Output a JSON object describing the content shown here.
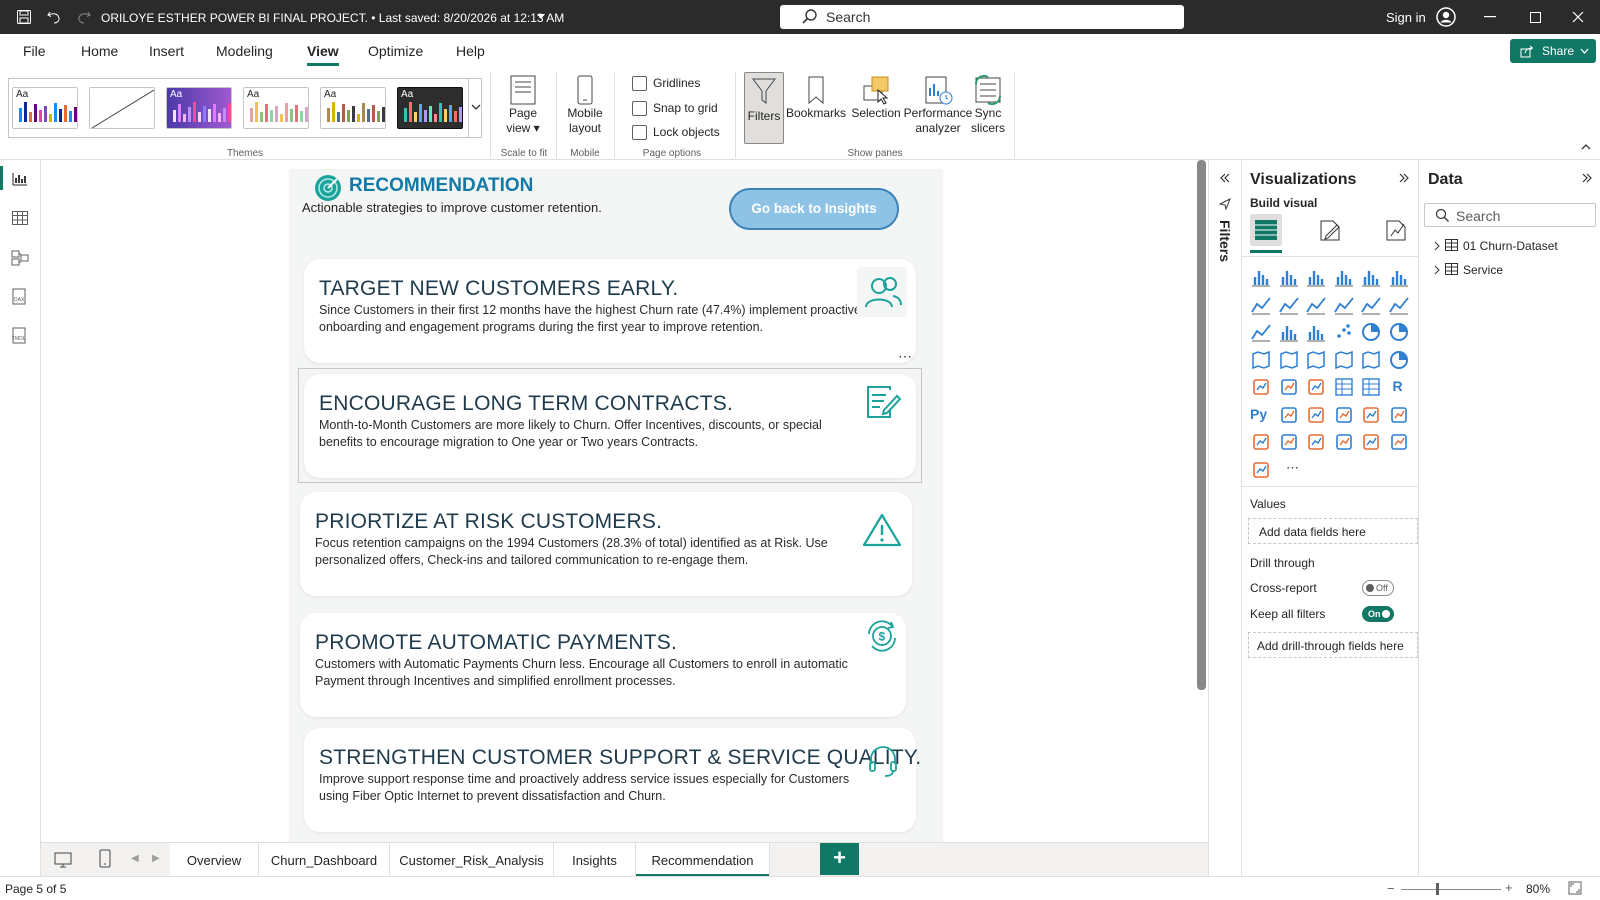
{
  "titlebar": {
    "title": "ORILOYE ESTHER POWER BI FINAL PROJECT. • Last saved: 8/20/2026 at 12:13 AM",
    "search_placeholder": "Search",
    "signin": "Sign in"
  },
  "menu": {
    "items": [
      "File",
      "Home",
      "Insert",
      "Modeling",
      "View",
      "Optimize",
      "Help"
    ],
    "active": "View",
    "share": "Share"
  },
  "ribbon": {
    "groups": {
      "themes": "Themes",
      "scale": "Scale to fit",
      "mobile": "Mobile",
      "page_options": "Page options",
      "show_panes": "Show panes"
    },
    "page_view": {
      "line1": "Page",
      "line2": "view"
    },
    "mobile_layout": {
      "line1": "Mobile",
      "line2": "layout"
    },
    "gridlines": "Gridlines",
    "snap_to_grid": "Snap to grid",
    "lock_objects": "Lock objects",
    "filters": "Filters",
    "bookmarks": "Bookmarks",
    "selection": "Selection",
    "performance": {
      "line1": "Performance",
      "line2": "analyzer"
    },
    "sync_slicers": {
      "line1": "Sync",
      "line2": "slicers"
    },
    "theme_aa": "Aa"
  },
  "report": {
    "heading": "RECOMMENDATION",
    "subheading": "Actionable strategies to improve customer retention.",
    "back_button": "Go back to Insights",
    "cards": [
      {
        "title": "TARGET NEW CUSTOMERS EARLY.",
        "body": "Since Customers in their first 12 months have the highest Churn rate (47.4%) implement proactive onboarding and engagement programs during the first year to improve retention.",
        "icon": "users-icon"
      },
      {
        "title": "ENCOURAGE LONG TERM CONTRACTS.",
        "body": "Month-to-Month Customers are more likely to Churn. Offer Incentives, discounts, or special benefits to encourage migration to One year or Two years Contracts.",
        "icon": "contract-edit-icon"
      },
      {
        "title": "PRIORTIZE AT RISK CUSTOMERS.",
        "body": "Focus retention campaigns on the 1994 Customers (28.3% of total) identified as at Risk. Use personalized offers, Check-ins and tailored communication to re-engage them.",
        "icon": "warning-icon"
      },
      {
        "title": "PROMOTE AUTOMATIC PAYMENTS.",
        "body": "Customers with Automatic Payments Churn less. Encourage all Customers to enroll in automatic Payment through Incentives and simplified enrollment processes.",
        "icon": "recurring-payment-icon"
      },
      {
        "title": "STRENGTHEN CUSTOMER SUPPORT & SERVICE QUALITY.",
        "body": "Improve support response time and proactively address service issues especially for Customers using Fiber Optic Internet to prevent dissatisfaction and Churn.",
        "icon": "headset-icon"
      }
    ]
  },
  "tabs": [
    "Overview",
    "Churn_Dashboard",
    "Customer_Risk_Analysis",
    "Insights",
    "Recommendation"
  ],
  "active_tab": "Recommendation",
  "status": {
    "page": "Page 5 of 5",
    "zoom": "80%"
  },
  "filters_label": "Filters",
  "visualizations": {
    "title": "Visualizations",
    "build_visual": "Build visual",
    "values": "Values",
    "add_data": "Add data fields here",
    "drill_through": "Drill through",
    "cross_report": "Cross-report",
    "cross_report_state": "Off",
    "keep_filters": "Keep all filters",
    "keep_filters_state": "On",
    "add_drill": "Add drill-through fields here",
    "python_label": "Py",
    "r_label": "R"
  },
  "data_pane": {
    "title": "Data",
    "search_placeholder": "Search",
    "tables": [
      "01 Churn-Dataset",
      "Service"
    ]
  },
  "colors": {
    "accent": "#117865",
    "teal_icon": "#1ba39c",
    "title_blue": "#1f3a4b",
    "heading_teal": "#127aa6"
  }
}
